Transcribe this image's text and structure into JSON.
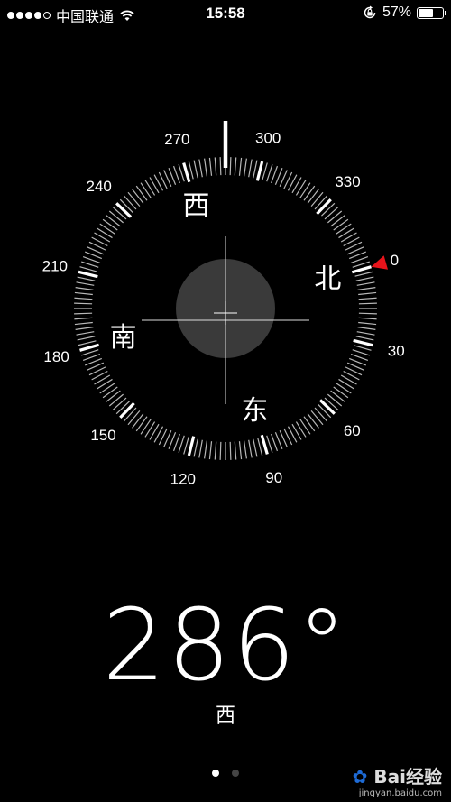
{
  "status_bar": {
    "carrier": "中国联通",
    "signal_strength": 4,
    "signal_max": 5,
    "time": "15:58",
    "battery_percent": "57%",
    "battery_level": 0.57
  },
  "compass": {
    "heading_degrees": 286,
    "heading_display": "286°",
    "heading_direction": "西",
    "cardinal_labels": {
      "north": "北",
      "east": "东",
      "south": "南",
      "west": "西"
    },
    "degree_labels": [
      "0",
      "30",
      "60",
      "90",
      "120",
      "150",
      "180",
      "210",
      "240",
      "270",
      "300",
      "330"
    ],
    "north_marker_color": "#e8141b"
  },
  "page_indicator": {
    "pages": 2,
    "active": 0
  },
  "watermark": {
    "logo": "Bai经验",
    "url": "jingyan.baidu.com"
  },
  "icons": [
    "wifi-icon",
    "orientation-lock-icon",
    "battery-icon",
    "north-marker-icon",
    "paw-icon"
  ]
}
